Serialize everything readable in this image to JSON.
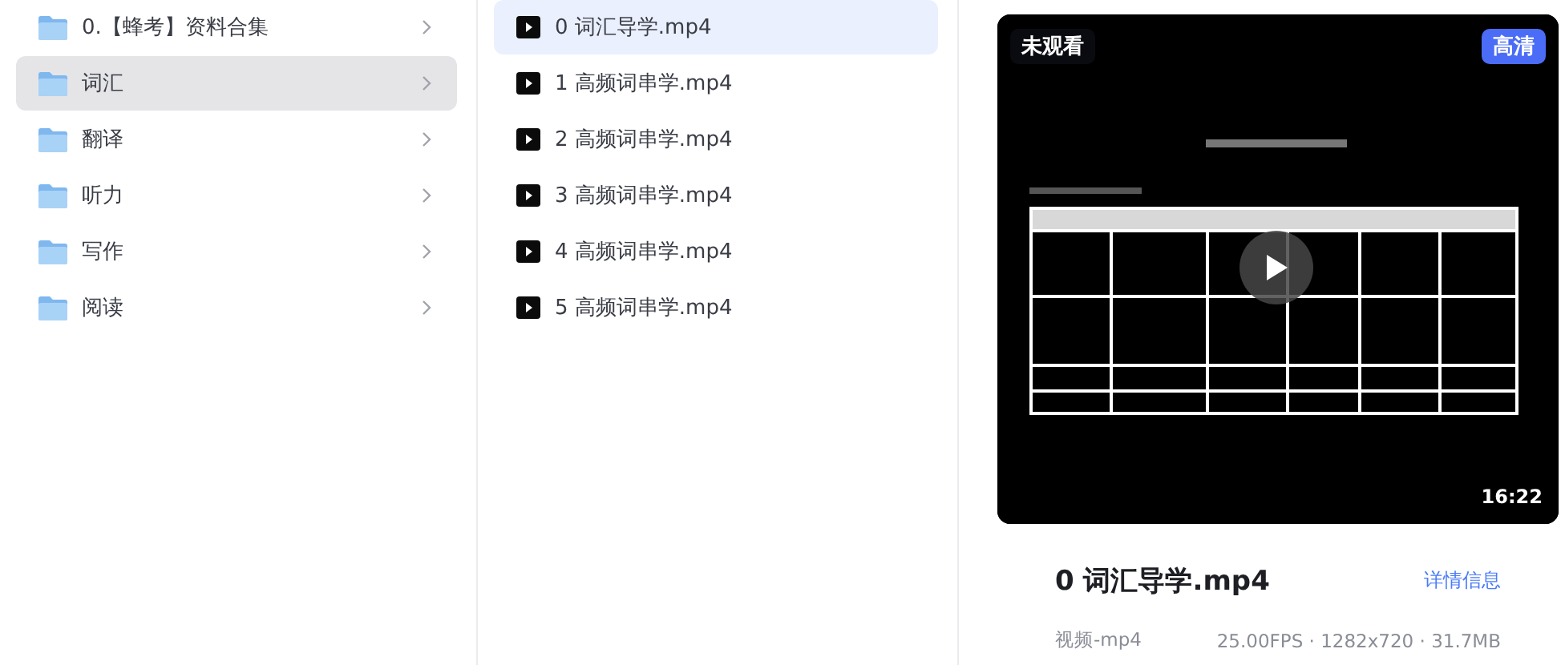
{
  "folders": [
    {
      "name": "0.【蜂考】资料合集",
      "selected": false
    },
    {
      "name": "词汇",
      "selected": true
    },
    {
      "name": "翻译",
      "selected": false
    },
    {
      "name": "听力",
      "selected": false
    },
    {
      "name": "写作",
      "selected": false
    },
    {
      "name": "阅读",
      "selected": false
    }
  ],
  "files": [
    {
      "name": "0 词汇导学.mp4",
      "selected": true
    },
    {
      "name": "1 高频词串学.mp4",
      "selected": false
    },
    {
      "name": "2 高频词串学.mp4",
      "selected": false
    },
    {
      "name": "3 高频词串学.mp4",
      "selected": false
    },
    {
      "name": "4 高频词串学.mp4",
      "selected": false
    },
    {
      "name": "5 高频词串学.mp4",
      "selected": false
    }
  ],
  "preview": {
    "watch_status": "未观看",
    "quality": "高清",
    "duration": "16:22",
    "title": "0 词汇导学.mp4",
    "details_link": "详情信息",
    "type": "视频-mp4",
    "specs": "25.00FPS · 1282x720 · 31.7MB"
  }
}
